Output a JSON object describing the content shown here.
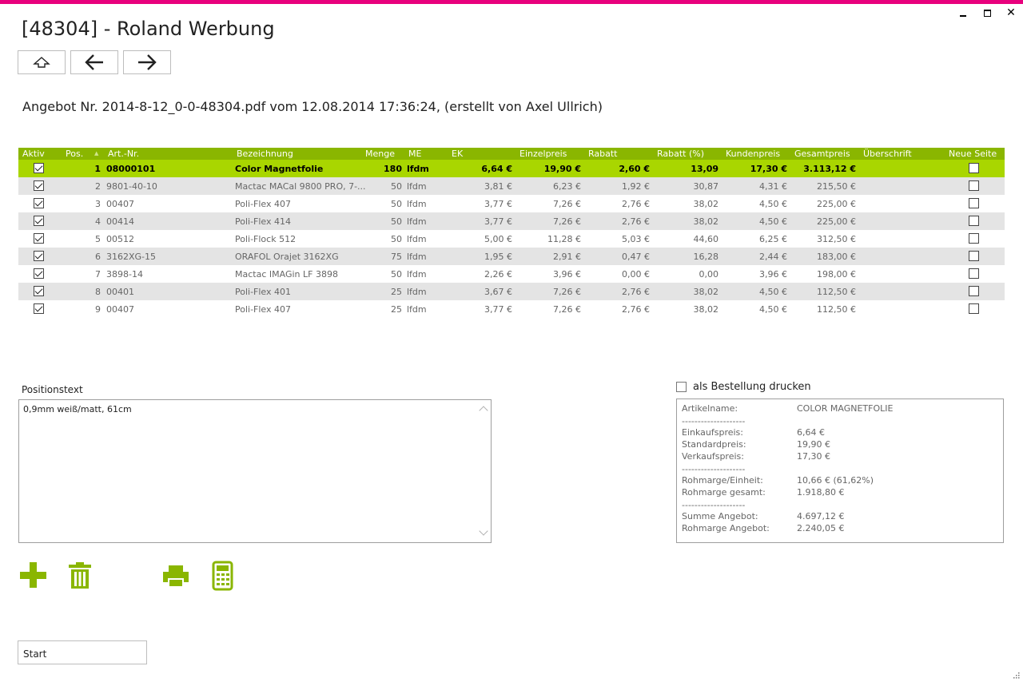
{
  "window": {
    "title": "[48304] - Roland Werbung",
    "accent_color": "#e8007d"
  },
  "nav": {
    "buttons": [
      "home-up-icon",
      "arrow-left-icon",
      "arrow-right-icon"
    ]
  },
  "document": {
    "subtitle": "Angebot Nr. 2014-8-12_0-0-48304.pdf vom 12.08.2014 17:36:24, (erstellt von Axel Ullrich)"
  },
  "grid": {
    "header_color": "#8ab600",
    "selected_color": "#a9d600",
    "columns": [
      "Aktiv",
      "Pos.",
      "Art.-Nr.",
      "Bezeichnung",
      "Menge",
      "ME",
      "EK",
      "Einzelpreis",
      "Rabatt",
      "Rabatt (%)",
      "Kundenpreis",
      "Gesamtpreis",
      "Überschrift",
      "Neue Seite"
    ],
    "rows": [
      {
        "aktiv": true,
        "pos": "1",
        "artnr": "08000101",
        "bez": "Color Magnetfolie",
        "menge": "180",
        "me": "lfdm",
        "ek": "6,64 €",
        "einzel": "19,90 €",
        "rabatt": "2,60 €",
        "rabattp": "13,09",
        "kunden": "17,30 €",
        "gesamt": "3.113,12 €",
        "neue": false
      },
      {
        "aktiv": true,
        "pos": "2",
        "artnr": "9801-40-10",
        "bez": "Mactac MACal 9800 PRO, 7-...",
        "menge": "50",
        "me": "lfdm",
        "ek": "3,81 €",
        "einzel": "6,23 €",
        "rabatt": "1,92 €",
        "rabattp": "30,87",
        "kunden": "4,31 €",
        "gesamt": "215,50 €",
        "neue": false
      },
      {
        "aktiv": true,
        "pos": "3",
        "artnr": "00407",
        "bez": "Poli-Flex 407",
        "menge": "50",
        "me": "lfdm",
        "ek": "3,77 €",
        "einzel": "7,26 €",
        "rabatt": "2,76 €",
        "rabattp": "38,02",
        "kunden": "4,50 €",
        "gesamt": "225,00 €",
        "neue": false
      },
      {
        "aktiv": true,
        "pos": "4",
        "artnr": "00414",
        "bez": "Poli-Flex 414",
        "menge": "50",
        "me": "lfdm",
        "ek": "3,77 €",
        "einzel": "7,26 €",
        "rabatt": "2,76 €",
        "rabattp": "38,02",
        "kunden": "4,50 €",
        "gesamt": "225,00 €",
        "neue": false
      },
      {
        "aktiv": true,
        "pos": "5",
        "artnr": "00512",
        "bez": "Poli-Flock 512",
        "menge": "50",
        "me": "lfdm",
        "ek": "5,00 €",
        "einzel": "11,28 €",
        "rabatt": "5,03 €",
        "rabattp": "44,60",
        "kunden": "6,25 €",
        "gesamt": "312,50 €",
        "neue": false
      },
      {
        "aktiv": true,
        "pos": "6",
        "artnr": "3162XG-15",
        "bez": "ORAFOL Orajet 3162XG",
        "menge": "75",
        "me": "lfdm",
        "ek": "1,95 €",
        "einzel": "2,91 €",
        "rabatt": "0,47 €",
        "rabattp": "16,28",
        "kunden": "2,44 €",
        "gesamt": "183,00 €",
        "neue": false
      },
      {
        "aktiv": true,
        "pos": "7",
        "artnr": "3898-14",
        "bez": "Mactac IMAGin LF 3898",
        "menge": "50",
        "me": "lfdm",
        "ek": "2,26 €",
        "einzel": "3,96 €",
        "rabatt": "0,00 €",
        "rabattp": "0,00",
        "kunden": "3,96 €",
        "gesamt": "198,00 €",
        "neue": false
      },
      {
        "aktiv": true,
        "pos": "8",
        "artnr": "00401",
        "bez": "Poli-Flex 401",
        "menge": "25",
        "me": "lfdm",
        "ek": "3,67 €",
        "einzel": "7,26 €",
        "rabatt": "2,76 €",
        "rabattp": "38,02",
        "kunden": "4,50 €",
        "gesamt": "112,50 €",
        "neue": false
      },
      {
        "aktiv": true,
        "pos": "9",
        "artnr": "00407",
        "bez": "Poli-Flex 407",
        "menge": "25",
        "me": "lfdm",
        "ek": "3,77 €",
        "einzel": "7,26 €",
        "rabatt": "2,76 €",
        "rabattp": "38,02",
        "kunden": "4,50 €",
        "gesamt": "112,50 €",
        "neue": false
      }
    ]
  },
  "positionstext": {
    "label": "Positionstext",
    "value": "0,9mm weiß/matt, 61cm"
  },
  "order_print": {
    "label": "als Bestellung drucken",
    "checked": false
  },
  "info": {
    "artikelname_label": "Artikelname:",
    "artikelname_value": "COLOR MAGNETFOLIE",
    "separator": "--------------------",
    "einkauf_label": "Einkaufspreis:",
    "einkauf_value": "6,64 €",
    "standard_label": "Standardpreis:",
    "standard_value": "19,90 €",
    "verkauf_label": "Verkaufspreis:",
    "verkauf_value": "17,30 €",
    "marge_einheit_label": "Rohmarge/Einheit:",
    "marge_einheit_value": "10,66 € (61,62%)",
    "marge_gesamt_label": "Rohmarge gesamt:",
    "marge_gesamt_value": "1.918,80 €",
    "summe_label": "Summe Angebot:",
    "summe_value": "4.697,12 €",
    "marge_angebot_label": "Rohmarge Angebot:",
    "marge_angebot_value": "2.240,05 €"
  },
  "tools": {
    "color": "#8ab600",
    "icons": [
      "add-icon",
      "trash-icon",
      "print-icon",
      "calculator-icon"
    ]
  },
  "start": {
    "value": "Start"
  }
}
